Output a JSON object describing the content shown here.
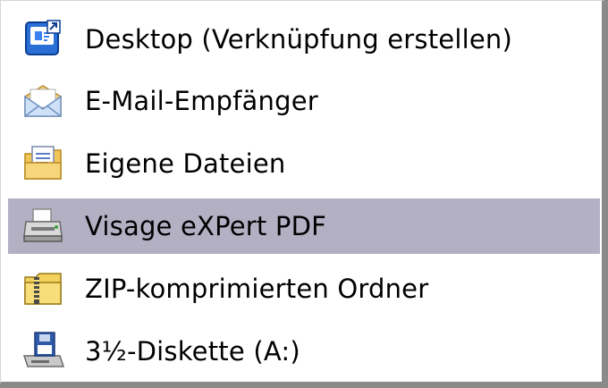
{
  "menu": {
    "items": [
      {
        "label": "Desktop (Verknüpfung erstellen)",
        "icon": "desktop-shortcut-icon",
        "selected": false
      },
      {
        "label": "E-Mail-Empfänger",
        "icon": "mail-envelope-icon",
        "selected": false
      },
      {
        "label": "Eigene Dateien",
        "icon": "my-documents-folder-icon",
        "selected": false
      },
      {
        "label": "Visage eXPert PDF",
        "icon": "printer-icon",
        "selected": true
      },
      {
        "label": "ZIP-komprimierten Ordner",
        "icon": "zip-folder-icon",
        "selected": false
      },
      {
        "label": "3½-Diskette (A:)",
        "icon": "floppy-drive-icon",
        "selected": false
      }
    ]
  },
  "colors": {
    "selection": "#b3b0c4",
    "border": "#8a8a8a"
  }
}
